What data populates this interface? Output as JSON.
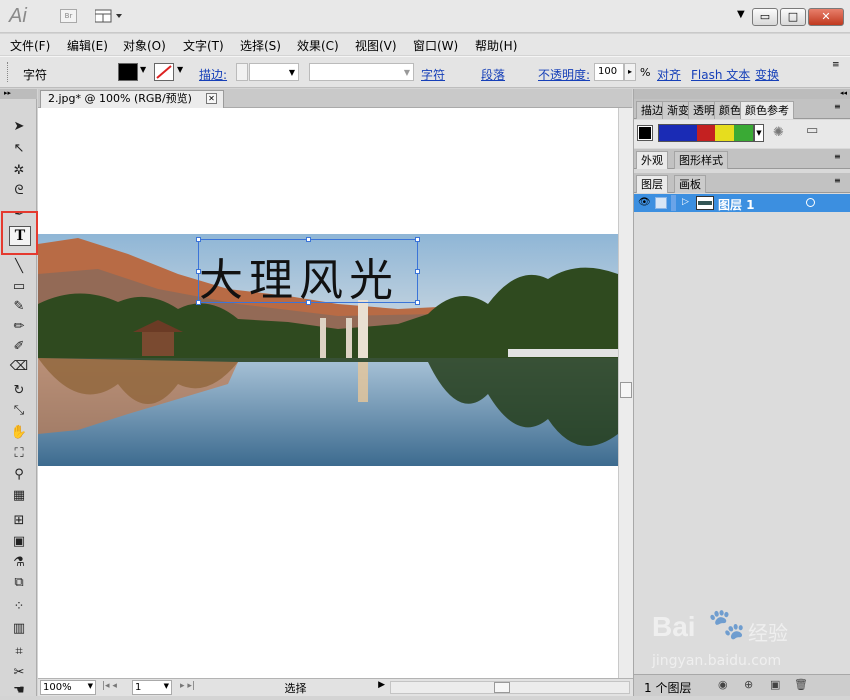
{
  "app": {
    "logo": "Ai",
    "bridge": "Br"
  },
  "window": {
    "minimize": "▭",
    "maximize": "□",
    "close": "✕",
    "menu_arrow": "▼"
  },
  "menu": [
    "文件(F)",
    "编辑(E)",
    "对象(O)",
    "文字(T)",
    "选择(S)",
    "效果(C)",
    "视图(V)",
    "窗口(W)",
    "帮助(H)"
  ],
  "control": {
    "mode": "字符",
    "stroke_label": "描边:",
    "char": "字符",
    "para": "段落",
    "opacity_label": "不透明度:",
    "opacity": "100",
    "percent": "%",
    "align": "对齐",
    "flash": "Flash 文本",
    "transform": "变换"
  },
  "document": {
    "tab": "2.jpg* @ 100% (RGB/预览)",
    "text": "大理风光"
  },
  "status": {
    "zoom": "100%",
    "page": "1",
    "mode": "选择"
  },
  "panels": {
    "group1": [
      "描边",
      "渐变",
      "透明",
      "颜色",
      "颜色参考"
    ],
    "group2": [
      "外观",
      "图形样式"
    ],
    "group3": [
      "图层",
      "画板"
    ],
    "layer_name": "图层 1",
    "layer_count": "1 个图层"
  },
  "colors": {
    "accent": "#3c8fe0",
    "selected_layer": "#3c8fe0",
    "highlight_box": "#e53a2f"
  },
  "swatches": [
    "#1a2bb5",
    "#1a2bb5",
    "#c42121",
    "#e6dd1e",
    "#3aaa35"
  ],
  "watermark": {
    "brand": "Bai",
    "brand2": "du",
    "suffix": "经验",
    "url": "jingyan.baidu.com"
  }
}
